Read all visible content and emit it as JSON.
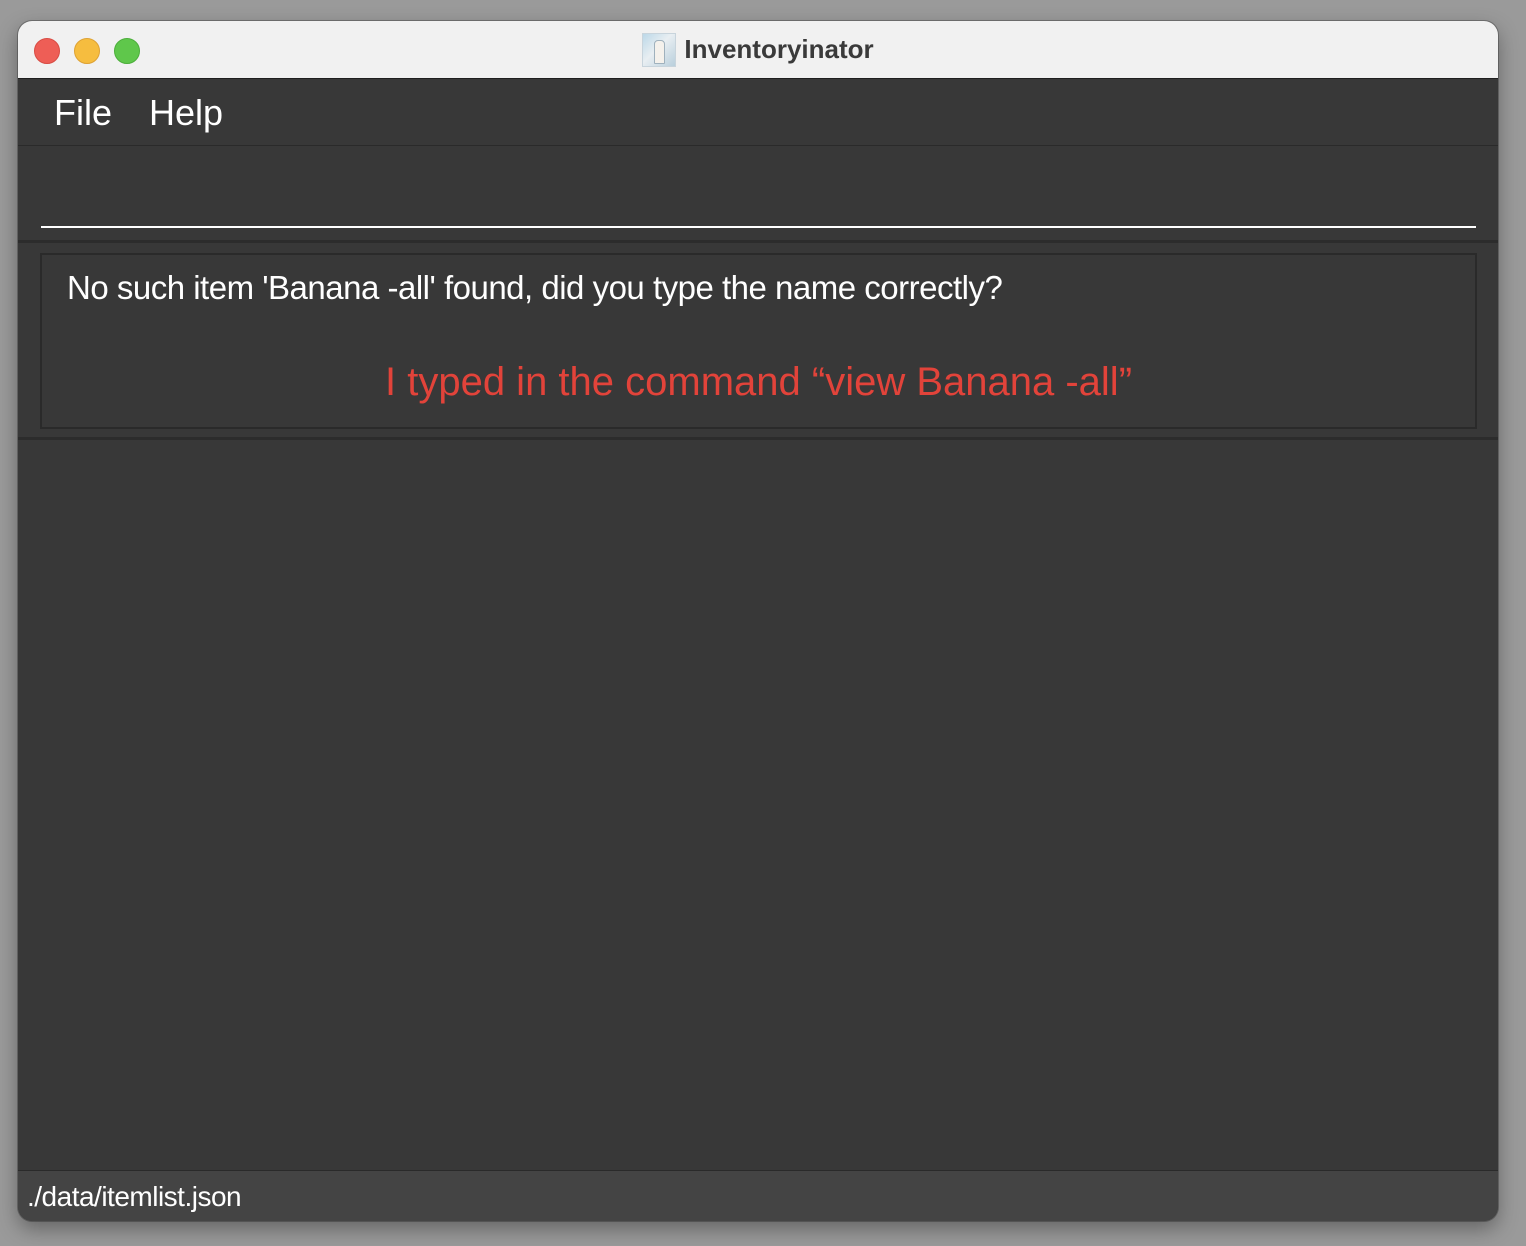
{
  "window": {
    "title": "Inventoryinator",
    "traffic_lights": {
      "close_color": "#ee5e56",
      "minimize_color": "#f6bd3f",
      "maximize_color": "#5fc74b"
    }
  },
  "menu": {
    "items": [
      {
        "label": "File"
      },
      {
        "label": "Help"
      }
    ]
  },
  "command_box": {
    "value": "",
    "placeholder": ""
  },
  "result_display": {
    "message": "No such item 'Banana -all' found, did you type the name correctly?",
    "annotation": "I typed in the command “view Banana -all”",
    "annotation_color": "#e2433a"
  },
  "status_bar": {
    "file_path": "./data/itemlist.json"
  },
  "icons": {
    "app_icon": "app-icon"
  }
}
